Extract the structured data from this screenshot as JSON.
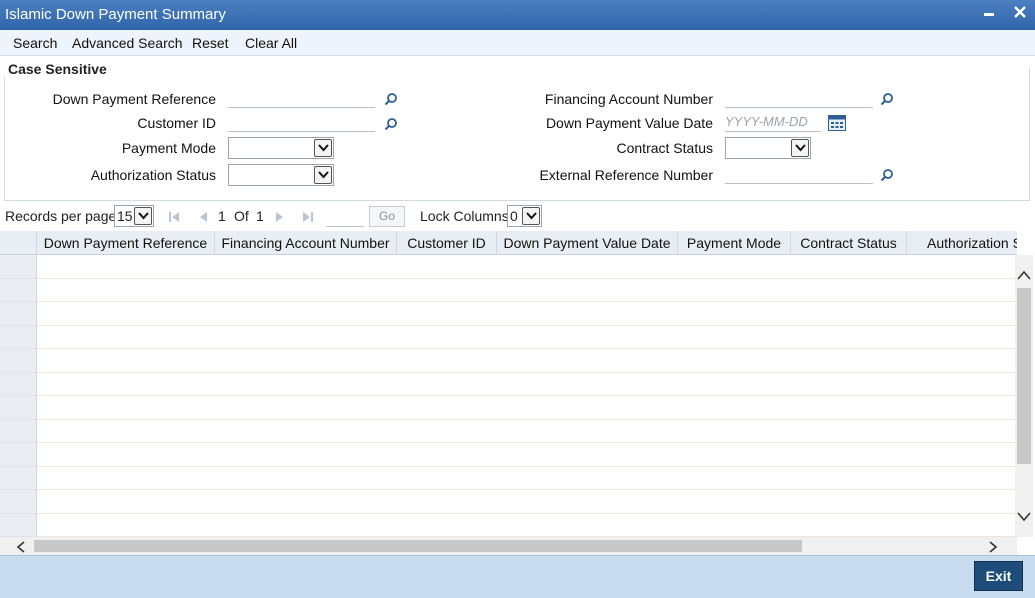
{
  "window": {
    "title": "Islamic Down Payment Summary",
    "minimize": "▬",
    "close": "✕"
  },
  "menu": {
    "search": "Search",
    "advanced_search": "Advanced Search",
    "reset": "Reset",
    "clear_all": "Clear All"
  },
  "criteria": {
    "legend": "Case Sensitive",
    "down_payment_reference": {
      "label": "Down Payment Reference",
      "value": ""
    },
    "customer_id": {
      "label": "Customer ID",
      "value": ""
    },
    "payment_mode": {
      "label": "Payment Mode",
      "value": ""
    },
    "authorization_status": {
      "label": "Authorization Status",
      "value": ""
    },
    "financing_account_number": {
      "label": "Financing Account Number",
      "value": ""
    },
    "down_payment_value_date": {
      "label": "Down Payment Value Date",
      "value": "",
      "placeholder": "YYYY-MM-DD"
    },
    "contract_status": {
      "label": "Contract Status",
      "value": ""
    },
    "external_reference_number": {
      "label": "External Reference Number",
      "value": ""
    }
  },
  "pager": {
    "records_per_page_label": "Records per page",
    "records_per_page": "15",
    "current_page": "1",
    "of_label": "Of",
    "total_pages": "1",
    "go_label": "Go",
    "lock_columns_label": "Lock Columns",
    "lock_columns": "0"
  },
  "grid": {
    "columns": [
      "Down Payment Reference",
      "Financing Account Number",
      "Customer ID",
      "Down Payment Value Date",
      "Payment Mode",
      "Contract Status",
      "Authorization S"
    ],
    "rows": []
  },
  "footer": {
    "exit_label": "Exit"
  },
  "colors": {
    "titlebar": "#2f65aa",
    "menubar": "#eef4fb",
    "footer": "#c8dcef",
    "exit_button": "#1f4d79"
  }
}
